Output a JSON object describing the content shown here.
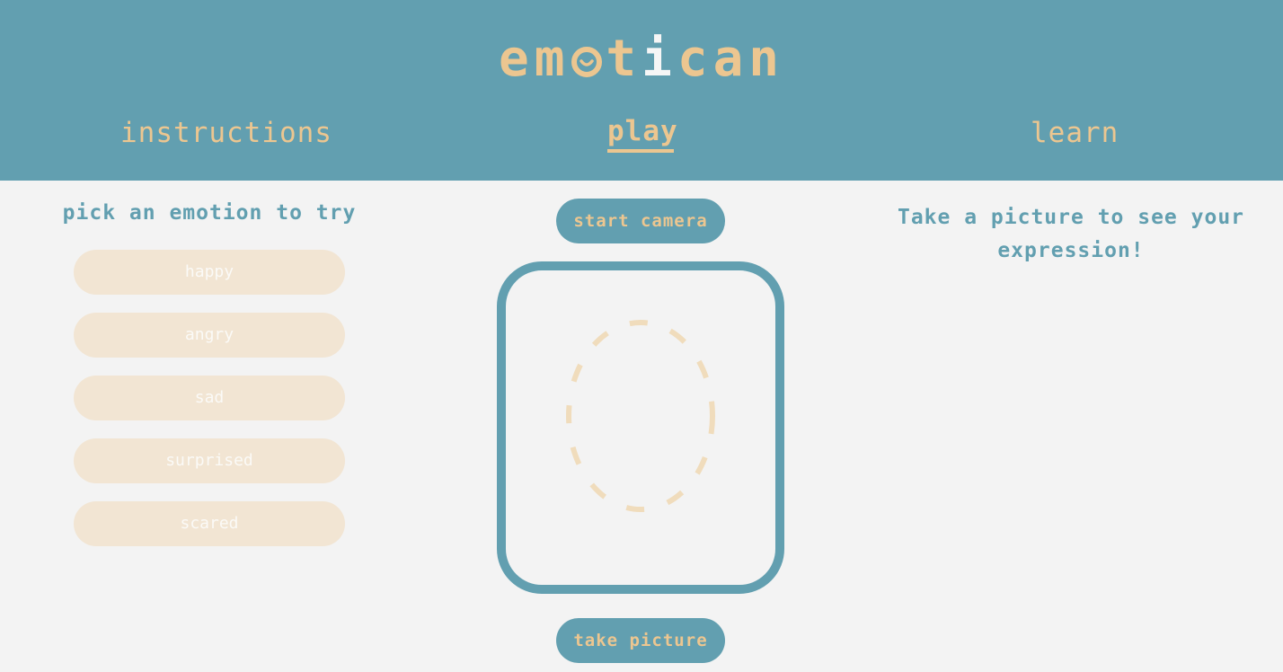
{
  "header": {
    "logo": {
      "part1": "em",
      "part2": "t",
      "part3": "i",
      "part4": "can"
    },
    "nav": [
      {
        "label": "instructions",
        "active": false
      },
      {
        "label": "play",
        "active": true
      },
      {
        "label": "learn",
        "active": false
      }
    ]
  },
  "emotions": {
    "title": "pick an emotion to try",
    "options": [
      "happy",
      "angry",
      "sad",
      "surprised",
      "scared"
    ]
  },
  "camera": {
    "start_label": "start camera",
    "take_label": "take picture"
  },
  "result": {
    "message": "Take a picture to see your expression!"
  },
  "colors": {
    "primary": "#629fb0",
    "accent": "#ecc690",
    "background": "#f3f3f3",
    "emotion_button": "#f2e5d3"
  },
  "icons": {
    "logo_o": "smiley-face-icon",
    "face_guide": "dashed-oval-face-guide"
  }
}
